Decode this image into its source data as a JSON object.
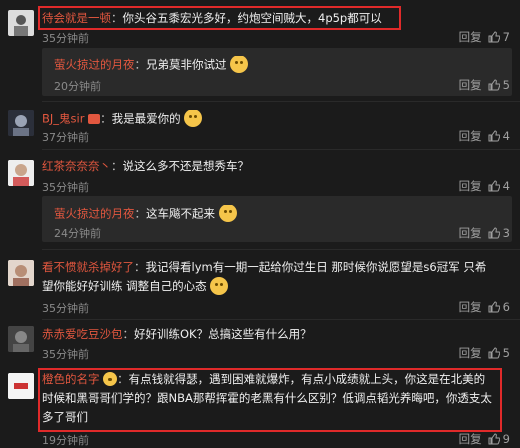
{
  "comments": [
    {
      "user": "待会就是一顿",
      "text": "你头谷五黍宏光多好，约炮空间贼大，4p5p都可以",
      "time": "35分钟前",
      "reply": "回复",
      "likes": "7"
    },
    {
      "user": "萤火掠过的月夜",
      "text": "兄弟莫非你试过",
      "time": "20分钟前",
      "reply": "回复",
      "likes": "5"
    },
    {
      "user": "BJ_鬼sir",
      "text": "我是最爱你的",
      "time": "37分钟前",
      "reply": "回复",
      "likes": "4"
    },
    {
      "user": "红茶奈奈奈丶",
      "text": "说这么多不还是想秀车？",
      "time": "35分钟前",
      "reply": "回复",
      "likes": "4"
    },
    {
      "user": "萤火掠过的月夜",
      "text": "这车飚不起来",
      "time": "24分钟前",
      "reply": "回复",
      "likes": "3"
    },
    {
      "user": "看不惯就杀掉好了",
      "text1": "我记得看lym有一期一起给你过生日 那时候你说愿望是s6冠军 只希",
      "text2": "望你能好好训练 调整自己的心态",
      "time": "35分钟前",
      "reply": "回复",
      "likes": "6"
    },
    {
      "user": "赤赤爱吃豆沙包",
      "text": "好好训练OK？总搞这些有什么用？",
      "time": "35分钟前",
      "reply": "回复",
      "likes": "5"
    },
    {
      "user": "橙色的名字",
      "text1": "有点钱就得瑟，遇到困难就爆炸，有点小成绩就上头，你这是在北美的",
      "text2": "时候和黑哥哥们学的？跟NBA那帮挥霍的老黑有什么区别？低调点韬光养晦吧，你透支太",
      "text3": "多了哥们",
      "time": "19分钟前",
      "reply": "回复",
      "likes": "9"
    }
  ],
  "colon": "：",
  "icons": {
    "like": "thumb-up-icon",
    "emoji": "smiley-emoji-icon",
    "badge": "vip-badge-icon"
  },
  "colors": {
    "username": "#e2573f",
    "highlight": "#e02a2a"
  }
}
